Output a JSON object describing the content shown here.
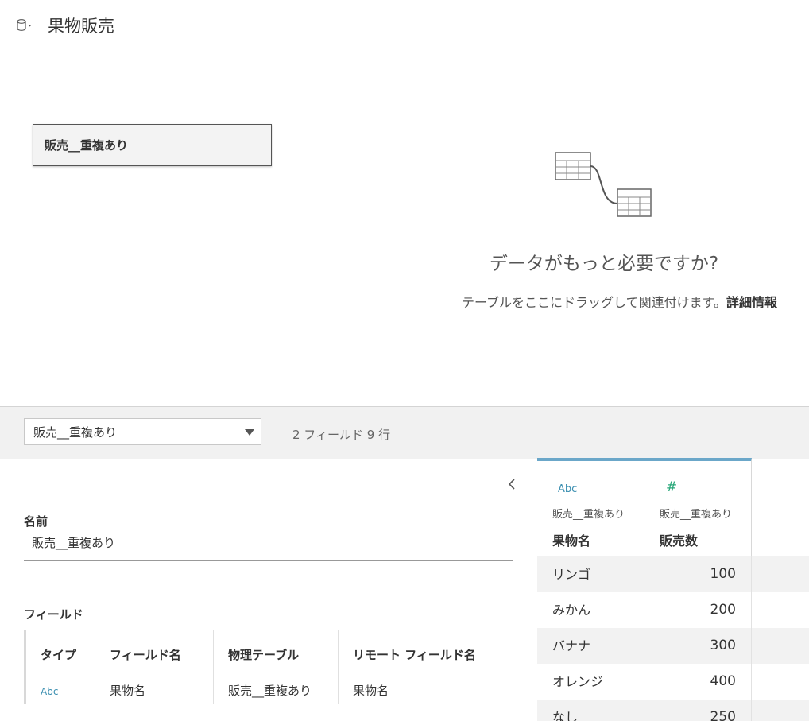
{
  "header": {
    "title": "果物販売",
    "icon": "database-icon"
  },
  "canvas": {
    "table_name": "販売__重複あり",
    "hint_title": "データがもっと必要ですか?",
    "hint_text": "テーブルをここにドラッグして関連付けます。",
    "hint_link": "詳細情報"
  },
  "toolbar": {
    "selected_table": "販売__重複あり",
    "field_count": "2 フィールド 9 行"
  },
  "metadata": {
    "name_label": "名前",
    "name_value": "販売__重複あり",
    "fields_label": "フィールド",
    "columns": [
      "タイプ",
      "フィールド名",
      "物理テーブル",
      "リモート フィールド名"
    ],
    "rows": [
      {
        "type": "Abc",
        "field": "果物名",
        "table": "販売__重複あり",
        "remote": "果物名"
      }
    ]
  },
  "grid": {
    "columns": [
      {
        "type": "Abc",
        "source": "販売__重複あり",
        "name": "果物名"
      },
      {
        "type": "#",
        "source": "販売__重複あり",
        "name": "販売数"
      }
    ],
    "rows": [
      {
        "name": "リンゴ",
        "value": "100"
      },
      {
        "name": "みかん",
        "value": "200"
      },
      {
        "name": "バナナ",
        "value": "300"
      },
      {
        "name": "オレンジ",
        "value": "400"
      },
      {
        "name": "なし",
        "value": "250"
      }
    ]
  },
  "colors": {
    "accent": "#6ba7c9",
    "string_type": "#3a8eb0",
    "number_type": "#2aa87a"
  }
}
